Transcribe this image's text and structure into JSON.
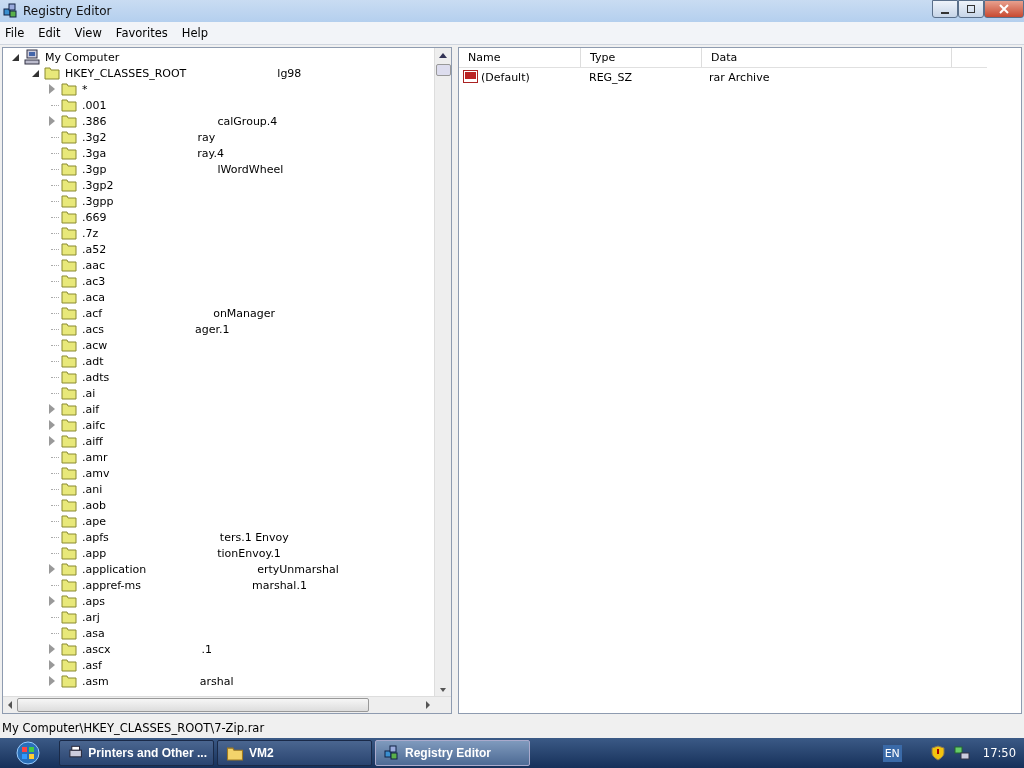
{
  "window": {
    "title": "Registry Editor"
  },
  "menu": [
    "File",
    "Edit",
    "View",
    "Favorites",
    "Help"
  ],
  "tree": {
    "label": "My Computer",
    "has_children": true,
    "expanded": true,
    "children": [
      {
        "label": "HKEY_CLASSES_ROOT",
        "ghost": "lg98",
        "has_children": true,
        "expanded": true,
        "children": [
          {
            "label": "*",
            "has_children": true,
            "expanded": false
          },
          {
            "label": ".001",
            "has_children": false
          },
          {
            "label": ".386",
            "ghost": "calGroup.4",
            "has_children": true,
            "expanded": false
          },
          {
            "label": ".3g2",
            "ghost": "ray",
            "has_children": false
          },
          {
            "label": ".3ga",
            "ghost": "ray.4",
            "has_children": false
          },
          {
            "label": ".3gp",
            "ghost": "lWordWheel",
            "has_children": false
          },
          {
            "label": ".3gp2",
            "has_children": false
          },
          {
            "label": ".3gpp",
            "has_children": false
          },
          {
            "label": ".669",
            "has_children": false
          },
          {
            "label": ".7z",
            "has_children": false
          },
          {
            "label": ".a52",
            "has_children": false
          },
          {
            "label": ".aac",
            "has_children": false
          },
          {
            "label": ".ac3",
            "has_children": false
          },
          {
            "label": ".aca",
            "has_children": false
          },
          {
            "label": ".acf",
            "ghost": "onManager",
            "has_children": false
          },
          {
            "label": ".acs",
            "ghost": "ager.1",
            "has_children": false
          },
          {
            "label": ".acw",
            "has_children": false
          },
          {
            "label": ".adt",
            "has_children": false
          },
          {
            "label": ".adts",
            "has_children": false
          },
          {
            "label": ".ai",
            "has_children": false
          },
          {
            "label": ".aif",
            "has_children": true,
            "expanded": false
          },
          {
            "label": ".aifc",
            "has_children": true,
            "expanded": false
          },
          {
            "label": ".aiff",
            "has_children": true,
            "expanded": false
          },
          {
            "label": ".amr",
            "has_children": false
          },
          {
            "label": ".amv",
            "has_children": false
          },
          {
            "label": ".ani",
            "has_children": false
          },
          {
            "label": ".aob",
            "has_children": false
          },
          {
            "label": ".ape",
            "has_children": false
          },
          {
            "label": ".apfs",
            "ghost": "ters.1 Envoy",
            "has_children": false
          },
          {
            "label": ".app",
            "ghost": "tionEnvoy.1",
            "has_children": false
          },
          {
            "label": ".application",
            "ghost": "ertyUnmarshal",
            "has_children": true,
            "expanded": false
          },
          {
            "label": ".appref-ms",
            "ghost": "marshal.1",
            "has_children": false
          },
          {
            "label": ".aps",
            "has_children": true,
            "expanded": false
          },
          {
            "label": ".arj",
            "has_children": false
          },
          {
            "label": ".asa",
            "has_children": false
          },
          {
            "label": ".ascx",
            "ghost": ".1",
            "has_children": true,
            "expanded": false
          },
          {
            "label": ".asf",
            "has_children": true,
            "expanded": false
          },
          {
            "label": ".asm",
            "ghost": "arshal",
            "has_children": true,
            "expanded": false
          }
        ]
      }
    ]
  },
  "values": {
    "columns": [
      "Name",
      "Type",
      "Data"
    ],
    "rows": [
      {
        "name": "(Default)",
        "type": "REG_SZ",
        "data": "rar Archive"
      }
    ]
  },
  "status_bar": "My Computer\\HKEY_CLASSES_ROOT\\7-Zip.rar",
  "taskbar": {
    "items": [
      {
        "label": "Printers and Other ...",
        "selected": false,
        "kind": "printer"
      },
      {
        "label": "VM2",
        "selected": false,
        "kind": "folder"
      },
      {
        "label": "Registry Editor",
        "selected": true,
        "kind": "regedit"
      }
    ],
    "language": "EN",
    "clock": "17:50"
  }
}
